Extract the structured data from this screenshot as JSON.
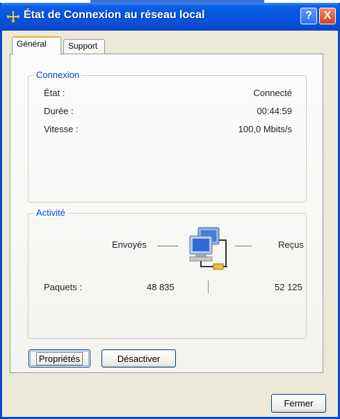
{
  "window": {
    "title": "État de Connexion au réseau local",
    "help_label": "?",
    "close_label": "X"
  },
  "tabs": [
    {
      "label": "Général",
      "active": true
    },
    {
      "label": "Support",
      "active": false
    }
  ],
  "connexion": {
    "heading": "Connexion",
    "rows": [
      {
        "label": "État :",
        "value": "Connecté"
      },
      {
        "label": "Durée :",
        "value": "00:44:59"
      },
      {
        "label": "Vitesse :",
        "value": "100,0 Mbits/s"
      }
    ]
  },
  "activite": {
    "heading": "Activité",
    "sent_label": "Envoyés",
    "received_label": "Reçus",
    "packets_label": "Paquets :",
    "packets_sent": "48 835",
    "packets_received": "52 125",
    "icon": "network-computers-icon"
  },
  "buttons": {
    "proprietes": "Propriétés",
    "desactiver": "Désactiver",
    "fermer": "Fermer"
  },
  "colors": {
    "titlebar": "#0a5fe8",
    "group_heading": "#0046d5",
    "window_face": "#ece9d8"
  }
}
